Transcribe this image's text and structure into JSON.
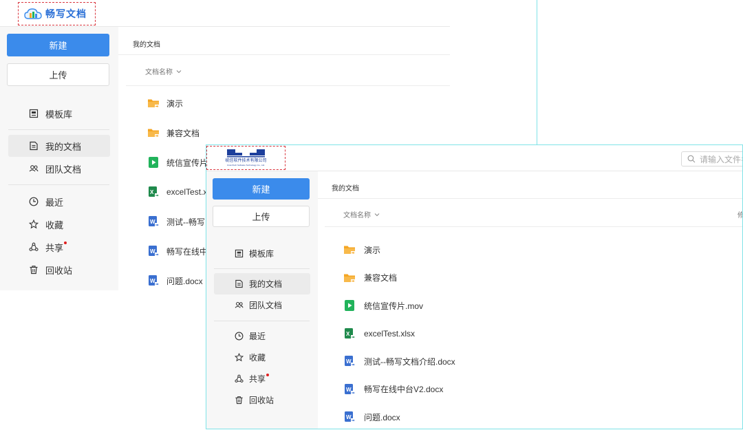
{
  "back_window": {
    "logo_text": "畅写文档",
    "sidebar": {
      "new_button": "新建",
      "upload_button": "上传",
      "nav_templates": "模板库",
      "nav_my_docs": "我的文档",
      "nav_team_docs": "团队文档",
      "nav_recent": "最近",
      "nav_favorites": "收藏",
      "nav_shared": "共享",
      "nav_trash": "回收站"
    },
    "breadcrumb": "我的文档",
    "column_name": "文档名称",
    "files": [
      {
        "name": "演示",
        "type": "folder"
      },
      {
        "name": "兼容文档",
        "type": "folder"
      },
      {
        "name": "统信宣传片",
        "type": "video"
      },
      {
        "name": "excelTest.x",
        "type": "excel"
      },
      {
        "name": "测试--畅写",
        "type": "word"
      },
      {
        "name": "畅写在线中",
        "type": "word"
      },
      {
        "name": "问题.docx",
        "type": "word"
      }
    ]
  },
  "front_window": {
    "logo_text": "统信软件技术有限公司",
    "logo_subtext": "UnionTech Software Technology Co., Ltd.",
    "search_placeholder": "请输入文件名",
    "sidebar": {
      "new_button": "新建",
      "upload_button": "上传",
      "nav_templates": "模板库",
      "nav_my_docs": "我的文档",
      "nav_team_docs": "团队文档",
      "nav_recent": "最近",
      "nav_favorites": "收藏",
      "nav_shared": "共享",
      "nav_trash": "回收站"
    },
    "breadcrumb": "我的文档",
    "column_name": "文档名称",
    "column_right_partial": "修",
    "files": [
      {
        "name": "演示",
        "type": "folder"
      },
      {
        "name": "兼容文档",
        "type": "folder"
      },
      {
        "name": "统信宣传片.mov",
        "type": "video"
      },
      {
        "name": "excelTest.xlsx",
        "type": "excel"
      },
      {
        "name": "测试--畅写文档介绍.docx",
        "type": "word"
      },
      {
        "name": "畅写在线中台V2.docx",
        "type": "word"
      },
      {
        "name": "问题.docx",
        "type": "word"
      }
    ]
  },
  "colors": {
    "accent": "#3b8beb",
    "guide": "#7fe3e8",
    "logo_dashed": "#d9363e",
    "folder": "#f5a623",
    "video": "#21b35b",
    "excel": "#1f8a4c",
    "word": "#3a6fd0",
    "notify_dot": "#e02020"
  }
}
